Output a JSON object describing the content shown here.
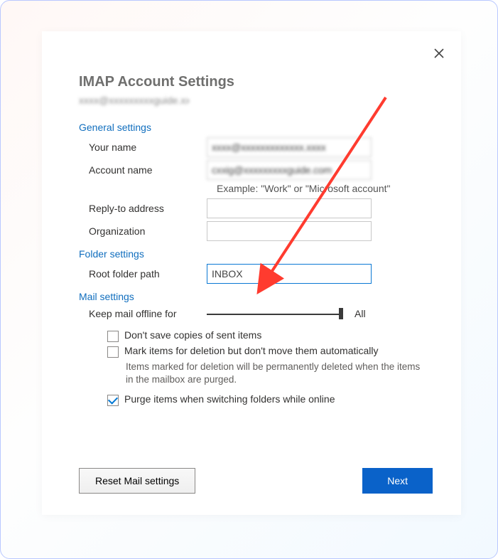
{
  "title": "IMAP Account Settings",
  "obscured_subtitle": "xxxx@xxxxxxxxxguide.xxxx",
  "sections": {
    "general": {
      "heading": "General settings",
      "your_name_label": "Your name",
      "your_name_value": "xxxx@xxxxxxxxxxxxx.xxxx",
      "account_name_label": "Account name",
      "account_name_value": "cxxig@xxxxxxxxxguide.com",
      "example_text": "Example: \"Work\" or \"Microsoft account\"",
      "reply_to_label": "Reply-to address",
      "reply_to_value": "",
      "organization_label": "Organization",
      "organization_value": ""
    },
    "folder": {
      "heading": "Folder settings",
      "root_path_label": "Root folder path",
      "root_path_value": "INBOX"
    },
    "mail": {
      "heading": "Mail settings",
      "keep_offline_label": "Keep mail offline for",
      "keep_offline_value": "All",
      "dont_save_sent_label": "Don't save copies of sent items",
      "dont_save_sent_checked": false,
      "mark_delete_label": "Mark items for deletion but don't move them automatically",
      "mark_delete_checked": false,
      "mark_delete_helper": "Items marked for deletion will be permanently deleted when the items in the mailbox are purged.",
      "purge_label": "Purge items when switching folders while online",
      "purge_checked": true
    }
  },
  "buttons": {
    "reset": "Reset Mail settings",
    "next": "Next"
  }
}
